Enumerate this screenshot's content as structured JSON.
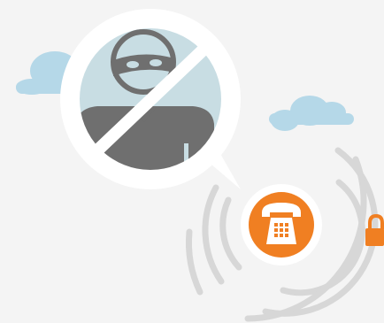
{
  "illustration": {
    "subject": "no-thief-icon",
    "phone_icon": "telephone-icon",
    "lock_icon": "padlock-icon",
    "cloud_icon": "cloud-icon"
  },
  "colors": {
    "background": "#f4f4f4",
    "cloud": "#b5d8e8",
    "bubble_fill": "#ffffff",
    "bubble_inner": "#c8dde3",
    "thief": "#6f6f6f",
    "prohibit_slash": "#ffffff",
    "phone_circle": "#f07f22",
    "phone_ring": "#ffffff",
    "signal_arcs": "#d7d7d7",
    "lock": "#f07f22"
  }
}
